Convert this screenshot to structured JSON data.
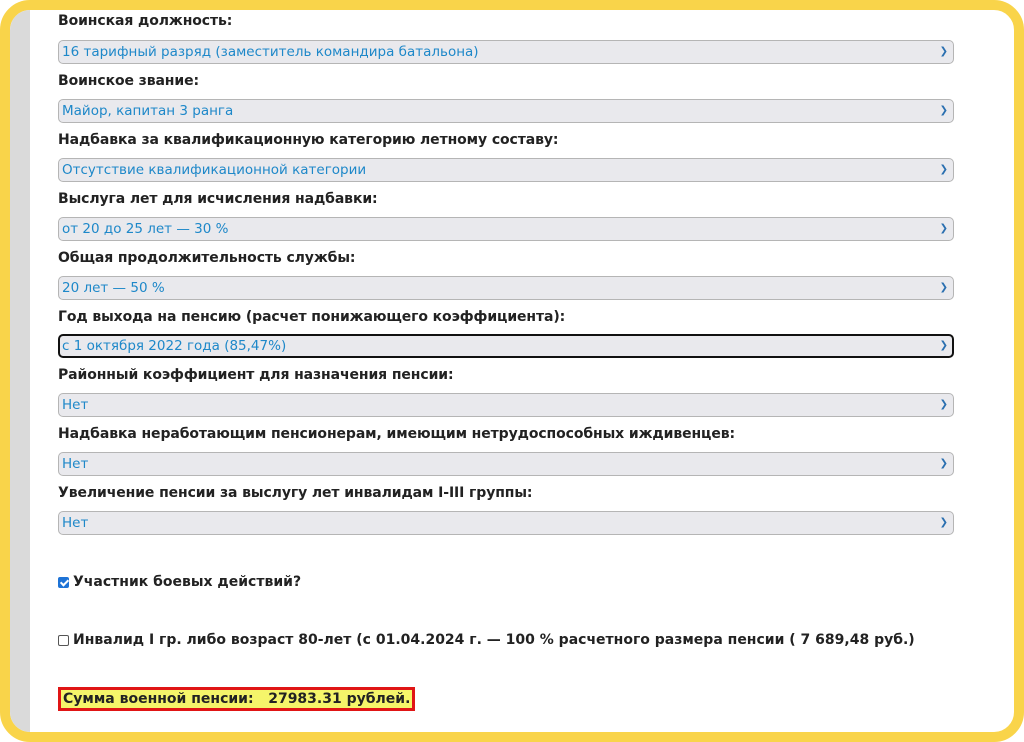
{
  "fields": [
    {
      "label": "Воинская должность:",
      "value": "16 тарифный разряд (заместитель командира батальона)"
    },
    {
      "label": "Воинское звание:",
      "value": "Майор, капитан 3 ранга"
    },
    {
      "label": "Надбавка за квалификационную категорию летному составу:",
      "value": "Отсутствие квалификационной категории"
    },
    {
      "label": "Выслуга лет для исчисления надбавки:",
      "value": "от 20 до 25 лет — 30 %"
    },
    {
      "label": "Общая продолжительность службы:",
      "value": "20 лет — 50 %"
    },
    {
      "label": "Год выхода на пенсию (расчет понижающего коэффициента):",
      "value": "с 1 октября 2022 года (85,47%)"
    },
    {
      "label": "Районный коэффициент для назначения пенсии:",
      "value": "Нет"
    },
    {
      "label": "Надбавка неработающим пенсионерам, имеющим нетрудоспособных иждивенцев:",
      "value": "Нет"
    },
    {
      "label": "Увеличение пенсии за выслугу лет инвалидам I-III группы:",
      "value": "Нет"
    }
  ],
  "checkboxes": [
    {
      "label": "Участник боевых действий?",
      "checked": true
    },
    {
      "label": "Инвалид I гр. либо возраст 80-лет (с 01.04.2024 г. — 100 % расчетного размера пенсии ( 7 689,48 руб.)",
      "checked": false
    }
  ],
  "result": {
    "text": "Сумма военной пенсии:   27983.31 рублей."
  },
  "colors": {
    "frame": "#f9d44a",
    "select_text": "#1e88c9",
    "result_bg": "#f5f56a",
    "result_border": "#e01515"
  }
}
